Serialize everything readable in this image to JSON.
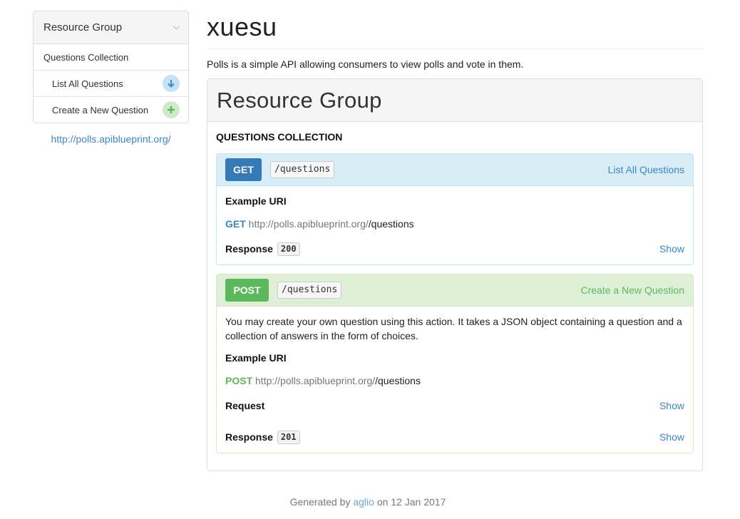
{
  "sidebar": {
    "heading": "Resource Group",
    "items": [
      {
        "label": "Questions Collection"
      },
      {
        "label": "List All Questions",
        "icon": "arrow-down-icon",
        "color": "#c5e3f3"
      },
      {
        "label": "Create a New Question",
        "icon": "plus-icon",
        "color": "#cfeacb"
      }
    ],
    "host_link": "http://polls.apiblueprint.org/"
  },
  "page": {
    "title": "xuesu",
    "intro": "Polls is a simple API allowing consumers to view polls and vote in them."
  },
  "group": {
    "title": "Resource Group",
    "resource_title": "QUESTIONS COLLECTION",
    "actions": [
      {
        "method": "GET",
        "path": "/questions",
        "name": "List All Questions",
        "example_label": "Example URI",
        "uri_method": "GET",
        "uri_host": "http://polls.apiblueprint.org/",
        "uri_path": "/questions",
        "response_label": "Response",
        "response_code": "200",
        "show_label": "Show",
        "color": "#337ab7"
      },
      {
        "method": "POST",
        "path": "/questions",
        "name": "Create a New Question",
        "description": "You may create your own question using this action. It takes a JSON object containing a question and a collection of answers in the form of choices.",
        "example_label": "Example URI",
        "uri_method": "POST",
        "uri_host": "http://polls.apiblueprint.org/",
        "uri_path": "/questions",
        "request_label": "Request",
        "request_show": "Show",
        "response_label": "Response",
        "response_code": "201",
        "show_label": "Show",
        "color": "#5cb85c"
      }
    ]
  },
  "footer": {
    "prefix": "Generated by",
    "link": "aglio",
    "suffix": "on 12 Jan 2017"
  }
}
